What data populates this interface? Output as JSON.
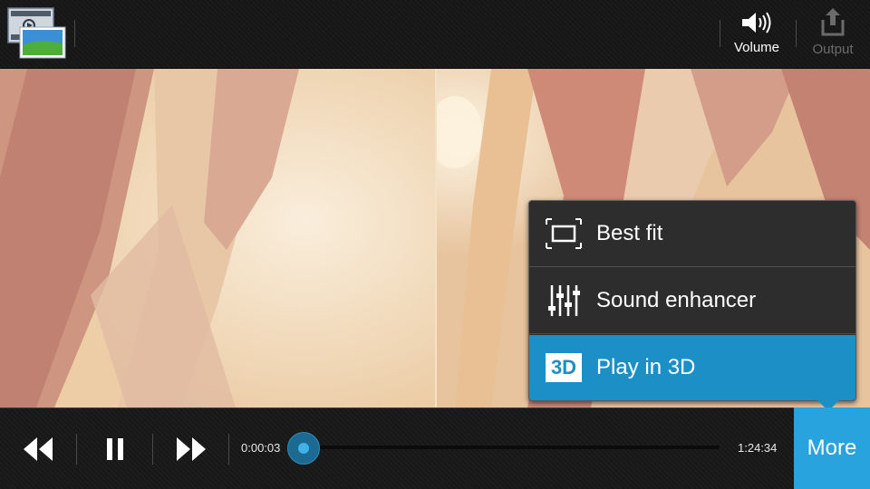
{
  "topbar": {
    "volume_label": "Volume",
    "output_label": "Output"
  },
  "menu": {
    "items": [
      {
        "label": "Best fit",
        "icon": "aspect-ratio-icon"
      },
      {
        "label": "Sound enhancer",
        "icon": "equalizer-icon"
      },
      {
        "label": "Play in 3D",
        "icon": "3d-icon",
        "icon_text": "3D",
        "selected": true
      }
    ]
  },
  "controls": {
    "current_time": "0:00:03",
    "total_time": "1:24:34",
    "more_label": "More"
  },
  "colors": {
    "accent": "#29a3dd",
    "selected_item": "#1c8fc6",
    "bar_background": "#1b1b1b"
  }
}
